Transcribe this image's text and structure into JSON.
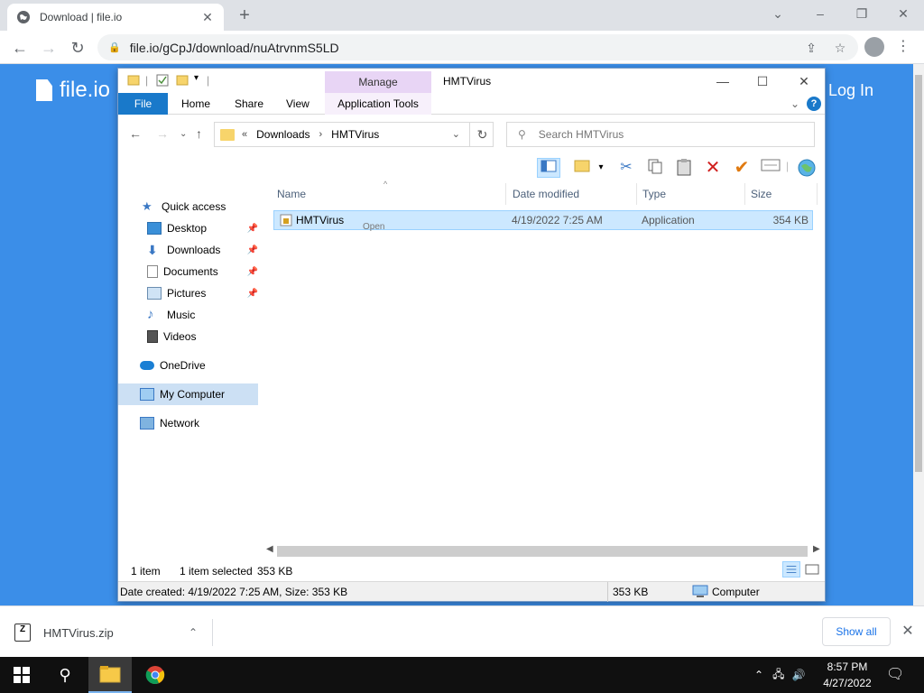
{
  "browser": {
    "tab_title": "Download | file.io",
    "new_tab": "+",
    "url": "file.io/gCpJ/download/nuAtrvnmS5LD"
  },
  "site": {
    "logo_text": "file.io",
    "login": "Log In"
  },
  "explorer": {
    "title": "HMTVirus",
    "manage_label": "Manage",
    "ribbon_tabs": [
      "File",
      "Home",
      "Share",
      "View",
      "Application Tools"
    ],
    "breadcrumb": {
      "overflow": "«",
      "items": [
        "Downloads",
        "HMTVirus"
      ]
    },
    "search_placeholder": "Search HMTVirus",
    "nav": {
      "quick_access": "Quick access",
      "desktop": "Desktop",
      "downloads": "Downloads",
      "documents": "Documents",
      "pictures": "Pictures",
      "music": "Music",
      "videos": "Videos",
      "onedrive": "OneDrive",
      "my_computer": "My Computer",
      "network": "Network"
    },
    "columns": {
      "name": "Name",
      "date": "Date modified",
      "type": "Type",
      "size": "Size"
    },
    "files": [
      {
        "name": "HMTVirus",
        "date": "4/19/2022 7:25 AM",
        "type": "Application",
        "size": "354 KB"
      }
    ],
    "ghost_text": "Open",
    "status": {
      "count": "1 item",
      "selected": "1 item selected",
      "sel_size": "353 KB"
    },
    "details": {
      "info": "Date created: 4/19/2022 7:25 AM, Size: 353 KB",
      "size": "353 KB",
      "location": "Computer"
    }
  },
  "downloads_bar": {
    "file": "HMTVirus.zip",
    "show_all": "Show all"
  },
  "taskbar": {
    "time": "8:57 PM",
    "date": "4/27/2022"
  },
  "colors": {
    "page_bg": "#3b8ee8",
    "file_tab": "#1979ca",
    "manage_tab": "#e8d5f5",
    "selection": "#cce8ff"
  }
}
